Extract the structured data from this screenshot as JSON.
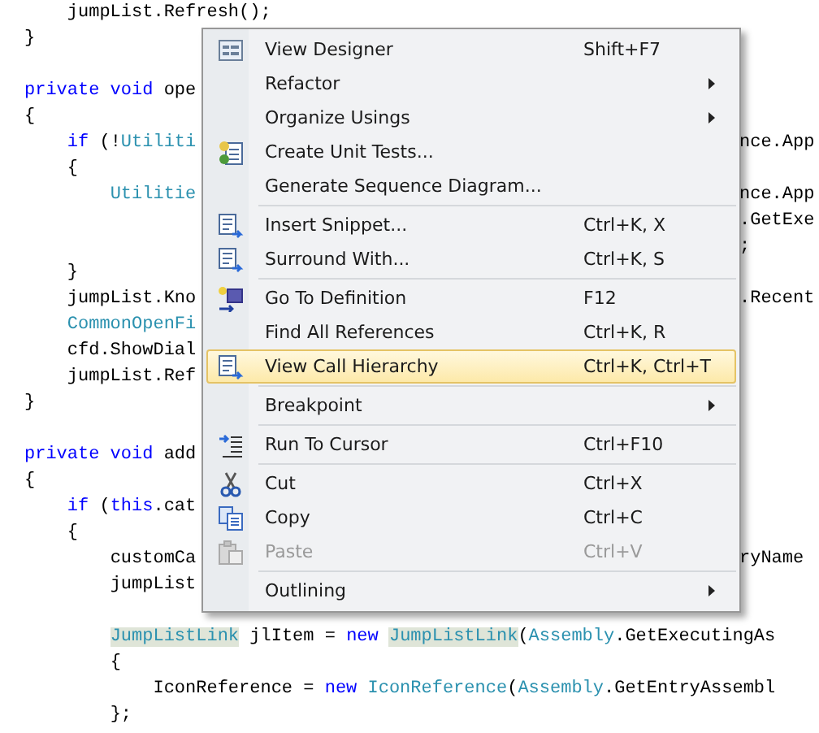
{
  "editor": {
    "blocks": [
      {
        "lines": [
          {
            "left": [
              {
                "text": "    jumpList.Refresh();",
                "kind": "plain"
              }
            ]
          },
          {
            "left": [
              {
                "text": "}",
                "kind": "plain"
              }
            ]
          }
        ]
      },
      {
        "lines": [
          {
            "left": [
              {
                "text": "private void",
                "kind": "keyword"
              },
              {
                "text": " ope",
                "kind": "plain"
              }
            ]
          },
          {
            "left": [
              {
                "text": "{",
                "kind": "plain"
              }
            ]
          },
          {
            "left": [
              {
                "text": "    if",
                "kind": "keyword"
              },
              {
                "text": " (!",
                "kind": "plain"
              },
              {
                "text": "Utiliti",
                "kind": "type"
              }
            ],
            "right": "nce.App"
          },
          {
            "left": [
              {
                "text": "    {",
                "kind": "plain"
              }
            ]
          },
          {
            "left": [
              {
                "text": "        Utilitie",
                "kind": "type"
              }
            ],
            "right": "nce.App"
          },
          {
            "right": ".GetExe"
          },
          {
            "right": ";"
          },
          {
            "left": [
              {
                "text": "    }",
                "kind": "plain"
              }
            ]
          },
          {
            "left": [
              {
                "text": "    jumpList.Kno",
                "kind": "plain"
              }
            ],
            "right": ".Recent"
          },
          {
            "left": [
              {
                "text": "    CommonOpenFi",
                "kind": "type"
              }
            ]
          },
          {
            "left": [
              {
                "text": "    cfd.ShowDial",
                "kind": "plain"
              }
            ]
          },
          {
            "left": [
              {
                "text": "    jumpList.Ref",
                "kind": "plain"
              }
            ]
          },
          {
            "left": [
              {
                "text": "}",
                "kind": "plain"
              }
            ]
          }
        ]
      },
      {
        "lines": [
          {
            "left": [
              {
                "text": "private void",
                "kind": "keyword"
              },
              {
                "text": " add",
                "kind": "plain"
              }
            ]
          },
          {
            "left": [
              {
                "text": "{",
                "kind": "plain"
              }
            ]
          },
          {
            "left": [
              {
                "text": "    if",
                "kind": "keyword"
              },
              {
                "text": " (",
                "kind": "plain"
              },
              {
                "text": "this",
                "kind": "keyword"
              },
              {
                "text": ".cat",
                "kind": "plain"
              }
            ]
          },
          {
            "left": [
              {
                "text": "    {",
                "kind": "plain"
              }
            ]
          },
          {
            "left": [
              {
                "text": "        customCa",
                "kind": "plain"
              }
            ],
            "right": "ryName"
          },
          {
            "left": [
              {
                "text": "        jumpList",
                "kind": "plain"
              }
            ]
          }
        ]
      },
      {
        "lines": [
          {
            "left": [
              {
                "text": "        JumpListLink",
                "kind": "reference"
              },
              {
                "text": " jlItem = ",
                "kind": "plain"
              },
              {
                "text": "new ",
                "kind": "keyword"
              },
              {
                "text": "JumpListLink",
                "kind": "reference"
              },
              {
                "text": "(",
                "kind": "plain"
              },
              {
                "text": "Assembly",
                "kind": "type"
              },
              {
                "text": ".GetExecutingAs",
                "kind": "plain"
              }
            ]
          },
          {
            "left": [
              {
                "text": "        {",
                "kind": "plain"
              }
            ]
          },
          {
            "left": [
              {
                "text": "            IconReference = ",
                "kind": "plain"
              },
              {
                "text": "new ",
                "kind": "keyword"
              },
              {
                "text": "IconReference",
                "kind": "type"
              },
              {
                "text": "(",
                "kind": "plain"
              },
              {
                "text": "Assembly",
                "kind": "type"
              },
              {
                "text": ".GetEntryAssembl",
                "kind": "plain"
              }
            ]
          },
          {
            "left": [
              {
                "text": "        };",
                "kind": "plain"
              }
            ]
          }
        ]
      }
    ]
  },
  "menu": {
    "groups": [
      {
        "items": [
          {
            "label": "View Designer",
            "shortcut": "Shift+F7",
            "submenu": false,
            "disabled": false,
            "selected": false
          },
          {
            "label": "Refactor",
            "submenu": true,
            "disabled": false,
            "selected": false
          },
          {
            "label": "Organize Usings",
            "submenu": true,
            "disabled": false,
            "selected": false
          },
          {
            "label": "Create Unit Tests...",
            "submenu": false,
            "disabled": false,
            "selected": false
          },
          {
            "label": "Generate Sequence Diagram...",
            "submenu": false,
            "disabled": false,
            "selected": false
          }
        ]
      },
      {
        "items": [
          {
            "label": "Insert Snippet...",
            "shortcut": "Ctrl+K, X",
            "submenu": false,
            "disabled": false,
            "selected": false
          },
          {
            "label": "Surround With...",
            "shortcut": "Ctrl+K, S",
            "submenu": false,
            "disabled": false,
            "selected": false
          }
        ]
      },
      {
        "items": [
          {
            "label": "Go To Definition",
            "shortcut": "F12",
            "submenu": false,
            "disabled": false,
            "selected": false
          },
          {
            "label": "Find All References",
            "shortcut": "Ctrl+K, R",
            "submenu": false,
            "disabled": false,
            "selected": false
          },
          {
            "label": "View Call Hierarchy",
            "shortcut": "Ctrl+K, Ctrl+T",
            "submenu": false,
            "disabled": false,
            "selected": true
          }
        ]
      },
      {
        "items": [
          {
            "label": "Breakpoint",
            "submenu": true,
            "disabled": false,
            "selected": false
          }
        ]
      },
      {
        "items": [
          {
            "label": "Run To Cursor",
            "shortcut": "Ctrl+F10",
            "submenu": false,
            "disabled": false,
            "selected": false
          }
        ]
      },
      {
        "items": [
          {
            "label": "Cut",
            "shortcut": "Ctrl+X",
            "submenu": false,
            "disabled": false,
            "selected": false
          },
          {
            "label": "Copy",
            "shortcut": "Ctrl+C",
            "submenu": false,
            "disabled": false,
            "selected": false
          },
          {
            "label": "Paste",
            "shortcut": "Ctrl+V",
            "submenu": false,
            "disabled": true,
            "selected": false
          }
        ]
      },
      {
        "items": [
          {
            "label": "Outlining",
            "submenu": true,
            "disabled": false,
            "selected": false
          }
        ]
      }
    ]
  }
}
